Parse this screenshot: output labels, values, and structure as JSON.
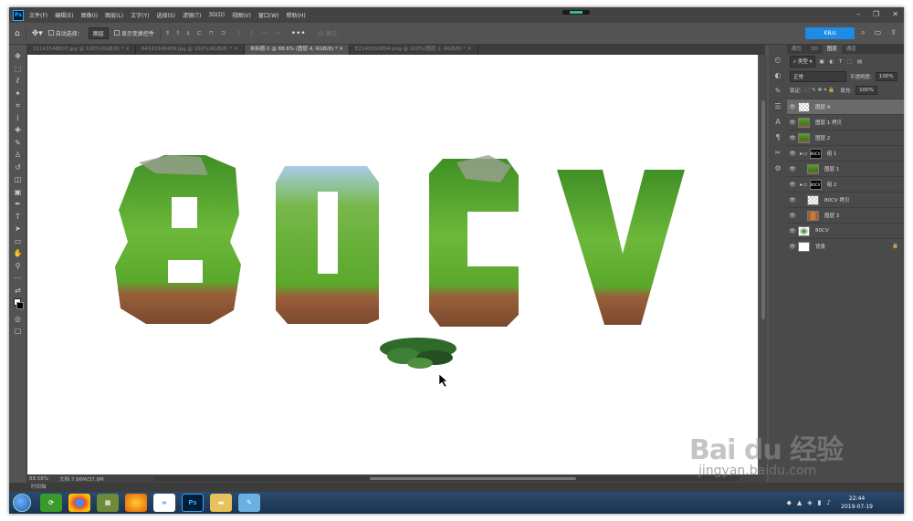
{
  "menu": {
    "items": [
      "文件(F)",
      "编辑(E)",
      "图像(I)",
      "图层(L)",
      "文字(Y)",
      "选择(S)",
      "滤镜(T)",
      "3D(D)",
      "视图(V)",
      "窗口(W)",
      "帮助(H)"
    ],
    "logo": "Ps"
  },
  "options": {
    "autoselect": "自动选择：",
    "layer_select": "图层",
    "transform": "显示变换控件",
    "mode_3d": "3D 模式：",
    "speed": "KB/s"
  },
  "tabs": [
    "31143548807.jpg @ 100%(RGB/8) *",
    "64143548458.jpg @ 100%(RGB/8) *",
    "未标题-1 @ 88.6% (图层 4, RGB/8) *",
    "E2143550804.png @ 100%(图层 1, RGB/8) *"
  ],
  "status": {
    "zoom": "88.58%",
    "doc": "文档:7.66M/37.9M"
  },
  "timeline": "时间轴",
  "canvas": {
    "letters": [
      "8",
      "0",
      "C",
      "V"
    ]
  },
  "panel": {
    "tabs": [
      "属性",
      "3D",
      "图层",
      "通道"
    ],
    "kind": "类型",
    "blend": "正常",
    "opacity_label": "不透明度:",
    "opacity": "100%",
    "lock_label": "锁定:",
    "fill_label": "填充:",
    "fill": "100%"
  },
  "layers": [
    {
      "name": "图层 4",
      "thumb": "t-check",
      "sel": true
    },
    {
      "name": "图层 1 拷贝",
      "thumb": "t-grass"
    },
    {
      "name": "图层 2",
      "thumb": "t-grass"
    },
    {
      "name": "组 1",
      "thumb": "t-black",
      "folder": true,
      "mask": "80CV"
    },
    {
      "name": "图层 1",
      "thumb": "t-grass",
      "indent": true
    },
    {
      "name": "组 2",
      "thumb": "t-black",
      "folder": true,
      "mask": "80CV"
    },
    {
      "name": "80CV 拷贝",
      "thumb": "t-check",
      "indent": true
    },
    {
      "name": "图层 3",
      "thumb": "t-brown",
      "indent": true
    },
    {
      "name": "80CV",
      "thumb": "t-ivy"
    },
    {
      "name": "背景",
      "thumb": "t-white",
      "lock": true
    }
  ],
  "taskbar": {
    "time": "22:44",
    "date": "2019-07-19"
  },
  "watermark": {
    "logo": "Bai du 经验",
    "url": "jingyan.baidu.com"
  }
}
